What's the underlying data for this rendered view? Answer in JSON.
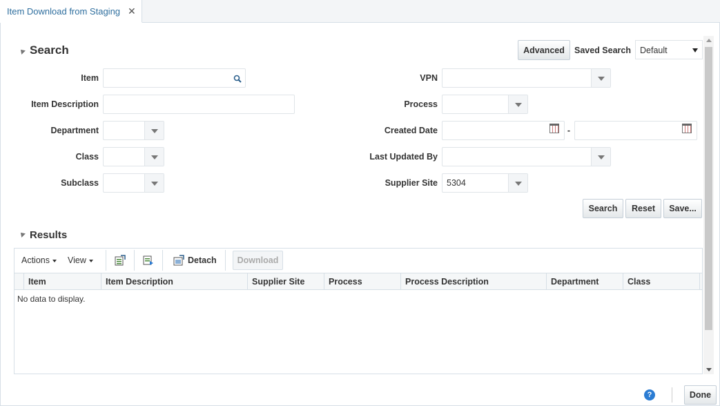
{
  "tab": {
    "title": "Item Download from Staging",
    "close_glyph": "✕"
  },
  "search": {
    "title": "Search",
    "advanced_label": "Advanced",
    "saved_search_label": "Saved Search",
    "saved_search_value": "Default",
    "fields_left": [
      {
        "label": "Item",
        "value": ""
      },
      {
        "label": "Item Description",
        "value": ""
      },
      {
        "label": "Department",
        "value": ""
      },
      {
        "label": "Class",
        "value": ""
      },
      {
        "label": "Subclass",
        "value": ""
      }
    ],
    "fields_right": [
      {
        "label": "VPN",
        "value": ""
      },
      {
        "label": "Process",
        "value": ""
      },
      {
        "label": "Created Date",
        "value": "",
        "separator": "-"
      },
      {
        "label": "Last Updated By",
        "value": ""
      },
      {
        "label": "Supplier Site",
        "value": "5304"
      }
    ],
    "buttons": {
      "search": "Search",
      "reset": "Reset",
      "save": "Save..."
    }
  },
  "results": {
    "title": "Results",
    "toolbar": {
      "actions": "Actions",
      "view": "View",
      "detach": "Detach",
      "download": "Download"
    },
    "columns": [
      "Item",
      "Item Description",
      "Supplier Site",
      "Process",
      "Process Description",
      "Department",
      "Class"
    ],
    "empty_text": "No data to display."
  },
  "footer": {
    "help": "?",
    "done": "Done"
  },
  "icons": [
    "close-icon",
    "search-icon",
    "dropdown-arrow-icon",
    "calendar-icon",
    "export-icon",
    "import-icon",
    "detach-icon",
    "help-icon",
    "collapse-triangle-icon"
  ]
}
